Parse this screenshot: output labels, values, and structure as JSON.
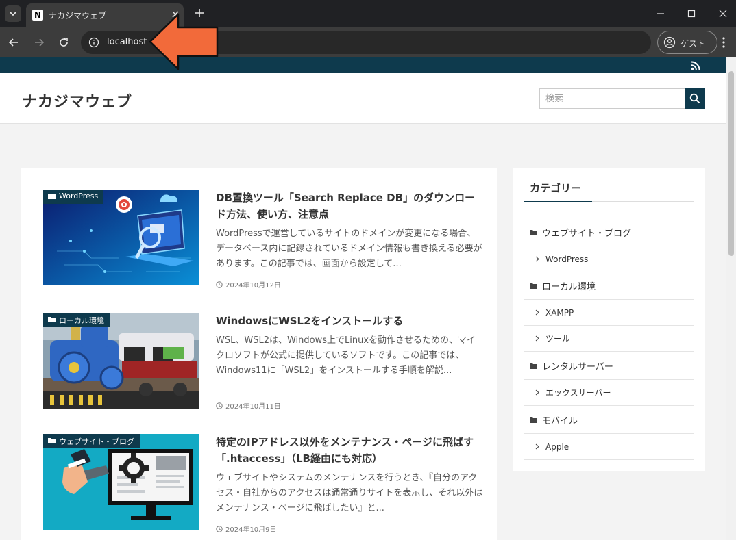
{
  "browser": {
    "tab_title": "ナカジマウェブ",
    "favicon_letter": "N",
    "url": "localhost",
    "profile_label": "ゲスト"
  },
  "site": {
    "title": "ナカジマウェブ",
    "search_placeholder": "検索"
  },
  "posts": [
    {
      "category": "WordPress",
      "title": "DB置換ツール「Search Replace DB」のダウンロード方法、使い方、注意点",
      "excerpt": "WordPressで運営しているサイトのドメインが変更になる場合、データベース内に記録されているドメイン情報も書き換える必要があります。この記事では、画面から設定して...",
      "date": "2024年10月12日"
    },
    {
      "category": "ローカル環境",
      "title": "WindowsにWSL2をインストールする",
      "excerpt": "WSL、WSL2は、Windows上でLinuxを動作させるための、マイクロソフトが公式に提供しているソフトです。この記事では、Windows11に「WSL2」をインストールする手順を解説...",
      "date": "2024年10月11日"
    },
    {
      "category": "ウェブサイト・ブログ",
      "title": "特定のIPアドレス以外をメンテナンス・ページに飛ばす「.htaccess」（LB経由にも対応）",
      "excerpt": "ウェブサイトやシステムのメンテナンスを行うとき、『自分のアクセス・自社からのアクセスは通常通りサイトを表示し、それ以外はメンテナンス・ページに飛ばしたい』と...",
      "date": "2024年10月9日"
    }
  ],
  "sidebar": {
    "title": "カテゴリー",
    "categories": [
      {
        "label": "ウェブサイト・ブログ",
        "level": "parent"
      },
      {
        "label": "WordPress",
        "level": "child"
      },
      {
        "label": "ローカル環境",
        "level": "parent"
      },
      {
        "label": "XAMPP",
        "level": "child"
      },
      {
        "label": "ツール",
        "level": "child"
      },
      {
        "label": "レンタルサーバー",
        "level": "parent"
      },
      {
        "label": "エックスサーバー",
        "level": "child"
      },
      {
        "label": "モバイル",
        "level": "parent"
      },
      {
        "label": "Apple",
        "level": "child"
      }
    ]
  },
  "colors": {
    "accent": "#0e3a4d",
    "arrow": "#f26a3a"
  }
}
